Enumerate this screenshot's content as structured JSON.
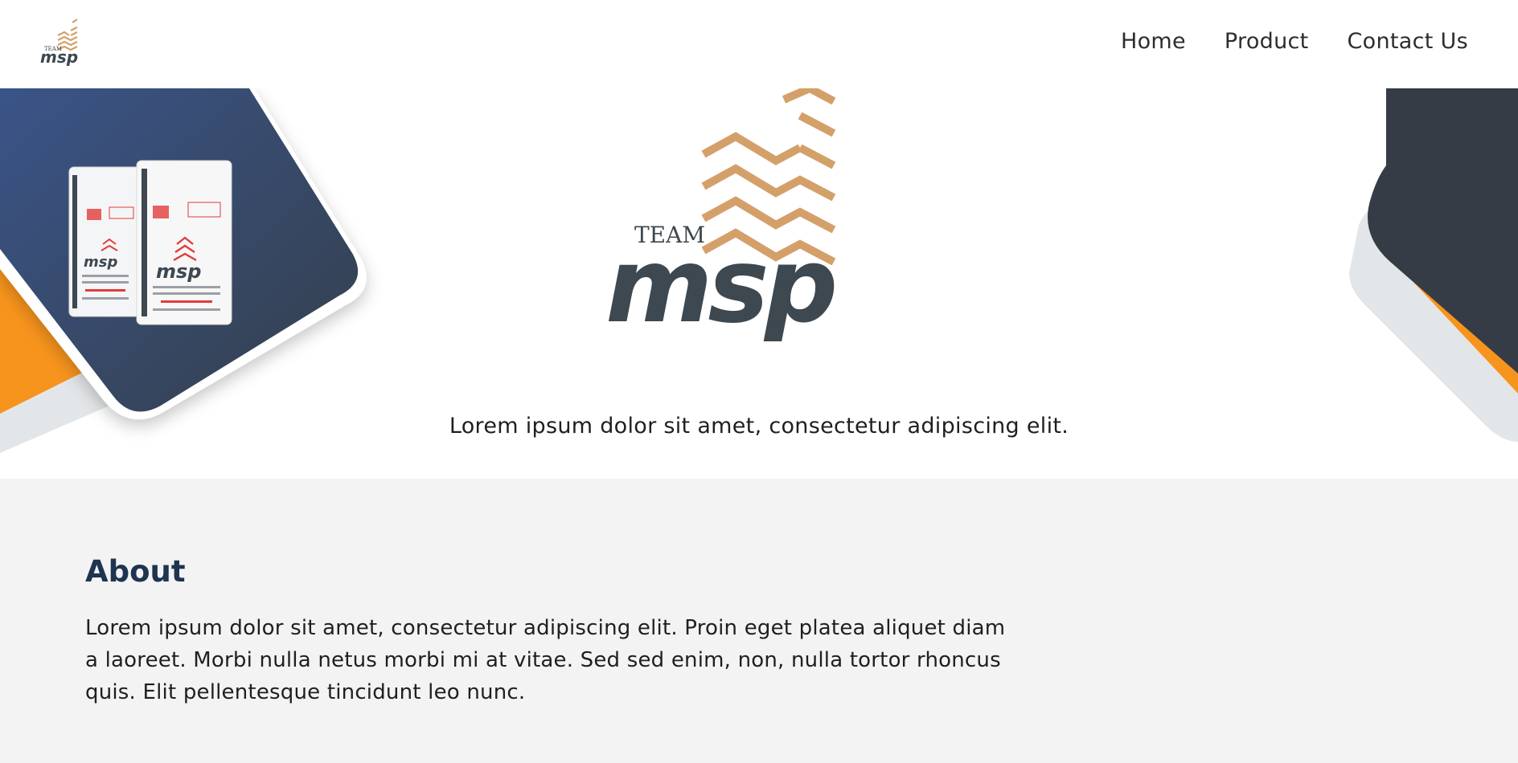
{
  "brand": {
    "logo_alt": "TEAM msp",
    "logo_team": "TEAM",
    "logo_msp": "msp",
    "colors": {
      "orange": "#f7941d",
      "navy": "#334e80",
      "slate": "#3d4850",
      "tan": "#d4a06a"
    }
  },
  "nav": {
    "items": [
      {
        "label": "Home"
      },
      {
        "label": "Product"
      },
      {
        "label": "Contact Us"
      }
    ]
  },
  "hero": {
    "product_bag_text": "msp",
    "tagline": "Lorem ipsum dolor sit amet, consectetur adipiscing elit."
  },
  "about": {
    "title": "About",
    "text": "Lorem ipsum dolor sit amet, consectetur adipiscing elit. Proin eget platea aliquet diam a laoreet. Morbi nulla netus morbi mi at vitae. Sed sed enim, non, nulla tortor rhoncus quis. Elit pellentesque tincidunt leo nunc."
  }
}
